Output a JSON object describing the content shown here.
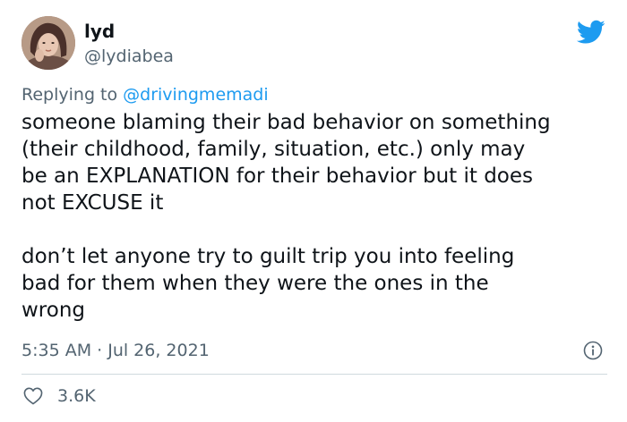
{
  "author": {
    "display_name": "lyd",
    "handle": "@lydiabea"
  },
  "reply": {
    "prefix": "Replying to ",
    "mention": "@drivingmemadi"
  },
  "tweet": {
    "paragraphs": [
      "someone blaming their bad behavior on something\n(their childhood, family, situation, etc.) only may\nbe an EXPLANATION for their behavior but it does\nnot EXCUSE it",
      "don’t let anyone try to guilt trip you into feeling\nbad for them when they were the ones in the\nwrong"
    ],
    "timestamp": "5:35 AM · Jul 26, 2021"
  },
  "engagement": {
    "likes": "3.6K"
  },
  "icons": {
    "logo": "twitter-bird-icon",
    "info": "info-icon",
    "like": "heart-icon"
  },
  "colors": {
    "brand": "#1d9bf0",
    "secondary_text": "#536471",
    "divider": "#cfd9de"
  }
}
